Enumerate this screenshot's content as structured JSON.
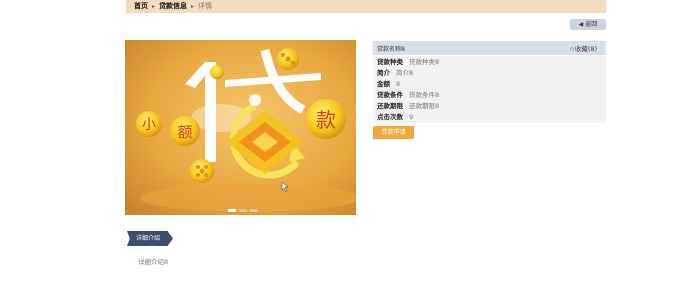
{
  "breadcrumb": {
    "home": "首页",
    "section": "贷款信息",
    "current": "详情"
  },
  "header": {
    "back_label": "返回"
  },
  "banner": {
    "glyph_big": "代",
    "coin_left_1": "小",
    "coin_left_2": "额",
    "coin_right": "款"
  },
  "info": {
    "name": "贷款名称8",
    "favorite": "收藏(8)",
    "rows": [
      {
        "label": "贷款种类",
        "value": "贷款种类8"
      },
      {
        "label": "简介",
        "value": "简介8"
      },
      {
        "label": "金额",
        "value": "8"
      },
      {
        "label": "贷款条件",
        "value": "贷款条件8"
      },
      {
        "label": "还款期限",
        "value": "还款期限8"
      },
      {
        "label": "点击次数",
        "value": "9"
      }
    ]
  },
  "actions": {
    "apply_label": "贷款申请"
  },
  "detail": {
    "tab_label": "详细介绍",
    "content": "详细介绍8"
  },
  "colors": {
    "topbar": "#f2dcc0",
    "accent": "#f0a93a",
    "tab": "#3e4e6d"
  }
}
